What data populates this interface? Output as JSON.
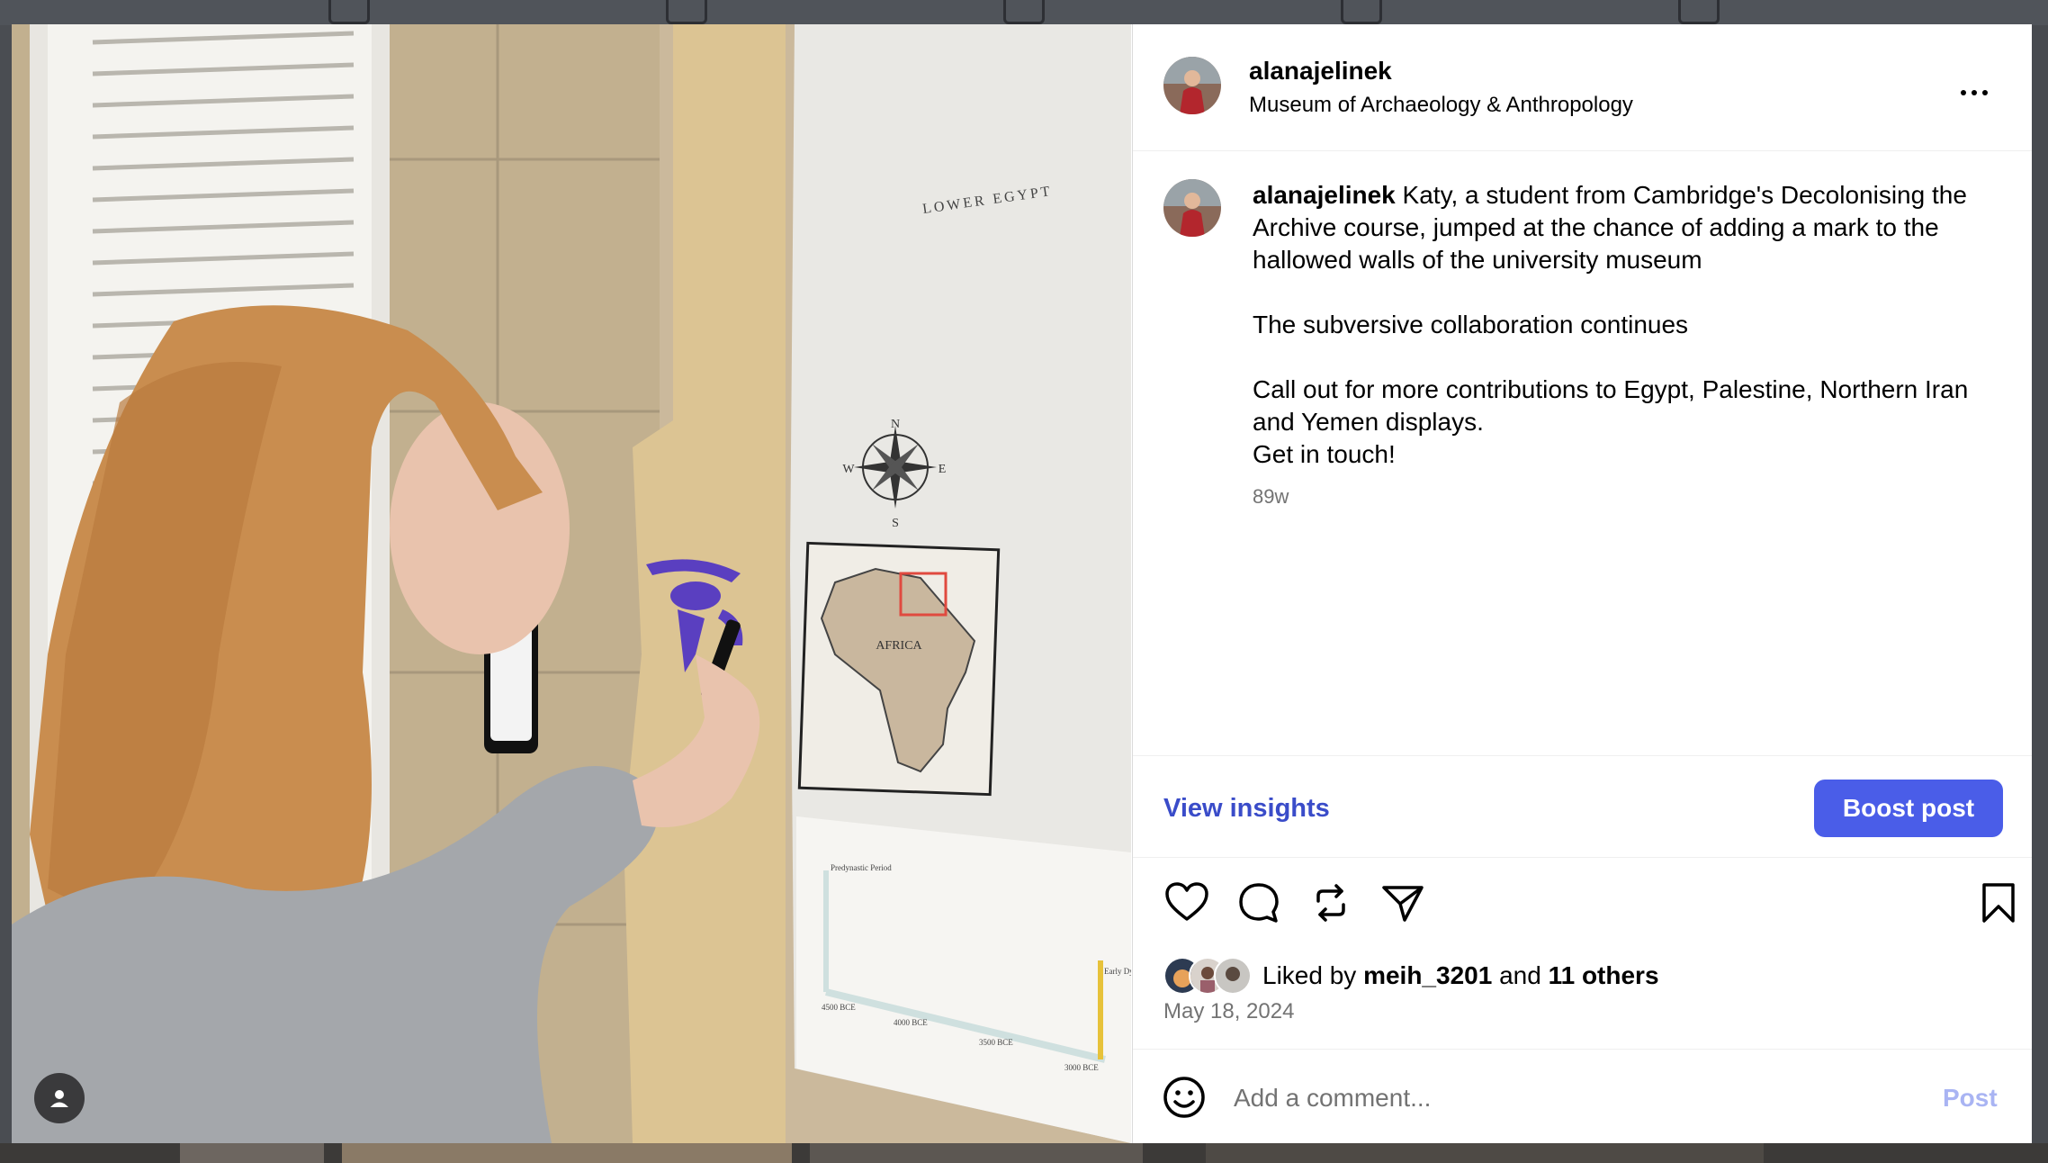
{
  "post": {
    "username": "alanajelinek",
    "location": "Museum of Archaeology & Anthropology",
    "caption_username": "alanajelinek",
    "caption_lines": [
      "Katy, a student from Cambridge's Decolonising the Archive course, jumped at the chance of adding a mark to the hallowed walls of the university museum",
      "The subversive collaboration continues",
      "Call out for more contributions to Egypt, Palestine, Northern Iran and Yemen displays.",
      "Get in touch!"
    ],
    "timestamp": "89w",
    "date": "May 18, 2024"
  },
  "insights": {
    "view_label": "View insights",
    "boost_label": "Boost post"
  },
  "likes": {
    "prefix": "Liked by",
    "user": "meih_3201",
    "joiner": "and",
    "others": "11 others"
  },
  "comment": {
    "placeholder": "Add a comment...",
    "post_label": "Post"
  },
  "photo_text": {
    "map_label": "AFRICA",
    "region_label": "LOWER EGYPT",
    "compass": {
      "n": "N",
      "s": "S",
      "e": "E",
      "w": "W"
    },
    "timeline_heading": "Predynastic Period",
    "timeline_ticks": [
      "4500 BCE",
      "4000 BCE",
      "3500 BCE",
      "3000 BCE"
    ],
    "timeline_end_label": "Early Dynastic Period"
  },
  "icons": {
    "like": "heart-icon",
    "comment": "comment-icon",
    "repost": "repost-icon",
    "share": "send-icon",
    "save": "bookmark-icon",
    "emoji": "emoji-icon",
    "more": "more-options-icon",
    "photo_user": "user-tag-icon"
  },
  "colors": {
    "accent": "#4a5de8",
    "link": "#3a4cc9",
    "muted": "#737373",
    "post_disabled": "#a9b4f3"
  }
}
